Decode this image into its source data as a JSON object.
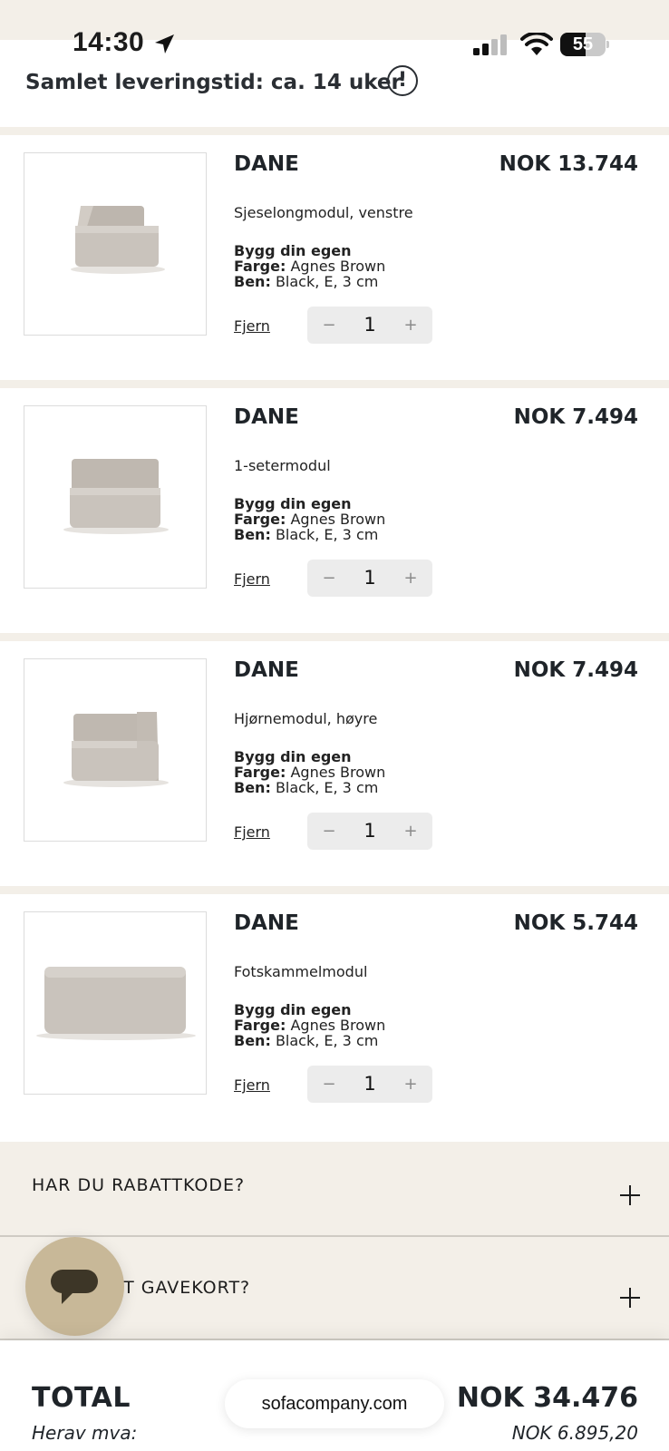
{
  "status_bar": {
    "time": "14:30",
    "battery": "55",
    "battery_level": 0.55
  },
  "header": {
    "delivery_text": "Samlet leveringstid: ca. 14 uker",
    "info_icon": "!"
  },
  "items": [
    {
      "brand": "DANE",
      "price": "NOK 13.744",
      "variant": "Sjeselongmodul, venstre",
      "spec_type": "Bygg din egen",
      "color_label": "Farge:",
      "color": "Agnes Brown",
      "legs_label": "Ben:",
      "legs": "Black, E, 3 cm",
      "remove": "Fjern",
      "qty": "1"
    },
    {
      "brand": "DANE",
      "price": "NOK 7.494",
      "variant": "1-setermodul",
      "spec_type": "Bygg din egen",
      "color_label": "Farge:",
      "color": "Agnes Brown",
      "legs_label": "Ben:",
      "legs": "Black, E, 3 cm",
      "remove": "Fjern",
      "qty": "1"
    },
    {
      "brand": "DANE",
      "price": "NOK 7.494",
      "variant": "Hjørnemodul, høyre",
      "spec_type": "Bygg din egen",
      "color_label": "Farge:",
      "color": "Agnes Brown",
      "legs_label": "Ben:",
      "legs": "Black, E, 3 cm",
      "remove": "Fjern",
      "qty": "1"
    },
    {
      "brand": "DANE",
      "price": "NOK 5.744",
      "variant": "Fotskammelmodul",
      "spec_type": "Bygg din egen",
      "color_label": "Farge:",
      "color": "Agnes Brown",
      "legs_label": "Ben:",
      "legs": "Black, E, 3 cm",
      "remove": "Fjern",
      "qty": "1"
    }
  ],
  "stepper": {
    "minus": "−",
    "plus": "+"
  },
  "accordions": {
    "discount": "HAR DU RABATTKODE?",
    "giftcard": "HAR DU ET GAVEKORT?"
  },
  "totals": {
    "label": "TOTAL",
    "value": "NOK 34.476",
    "vat_label": "Herav mva:",
    "vat_value": "NOK 6.895,20"
  },
  "browser": {
    "url": "sofacompany.com"
  },
  "colors": {
    "beige": "#f3efe8",
    "chat": "#c8b898",
    "text": "#1f2429"
  },
  "icons": [
    "location-arrow-icon",
    "signal-icon",
    "wifi-icon",
    "battery-icon",
    "info-icon",
    "plus-icon",
    "chat-icon"
  ]
}
